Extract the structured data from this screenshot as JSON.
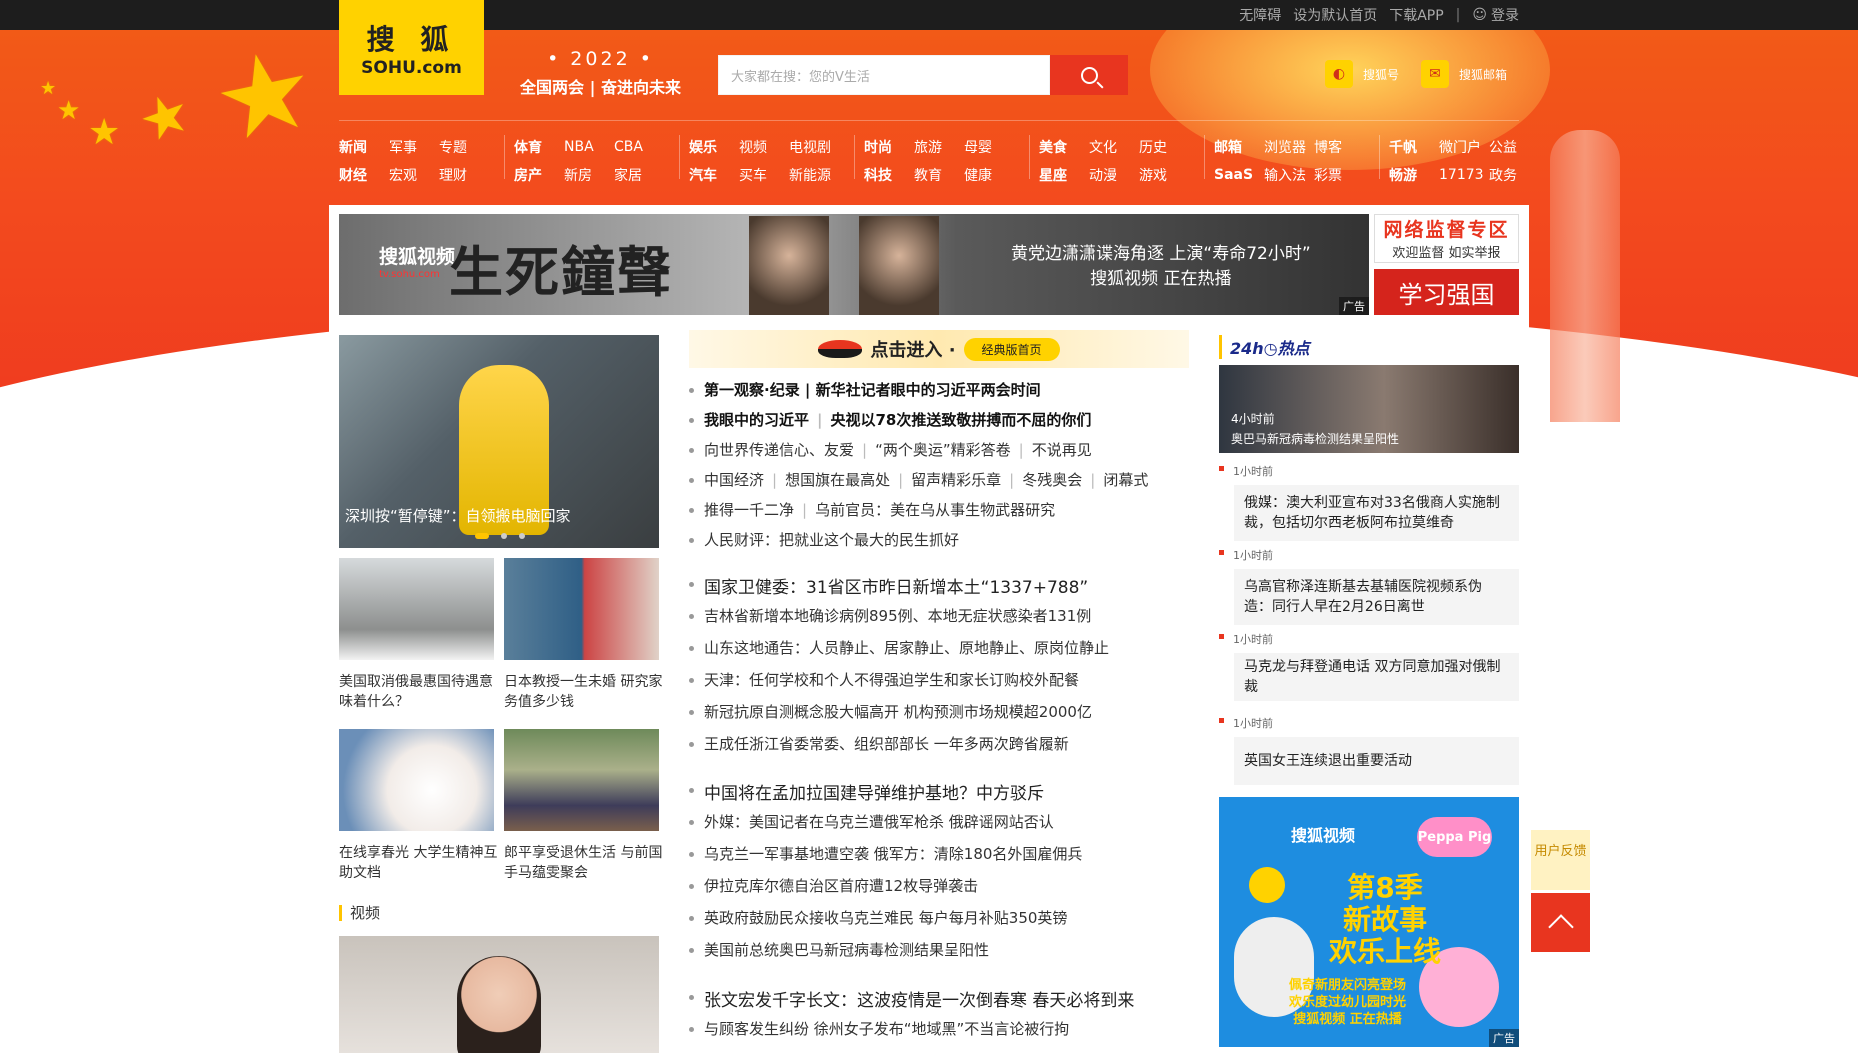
{
  "topbar": {
    "accessibility": "无障碍",
    "set_home": "设为默认首页",
    "download_app": "下载APP",
    "login": "登录"
  },
  "logo": {
    "cn": "搜 狐",
    "en": "SOHU.com"
  },
  "slogan": {
    "year": "• 2022 •",
    "text": "全国两会 | 奋进向未来"
  },
  "search": {
    "placeholder": "大家都在搜：您的V生活"
  },
  "account": {
    "sohuhao": "搜狐号",
    "mail": "搜狐邮箱"
  },
  "nav": {
    "groups": [
      {
        "row1": [
          "新闻",
          "军事",
          "专题"
        ],
        "row2": [
          "财经",
          "宏观",
          "理财"
        ]
      },
      {
        "row1": [
          "体育",
          "NBA",
          "CBA"
        ],
        "row2": [
          "房产",
          "新房",
          "家居"
        ]
      },
      {
        "row1": [
          "娱乐",
          "视频",
          "电视剧"
        ],
        "row2": [
          "汽车",
          "买车",
          "新能源"
        ]
      },
      {
        "row1": [
          "时尚",
          "旅游",
          "母婴"
        ],
        "row2": [
          "科技",
          "教育",
          "健康"
        ]
      },
      {
        "row1": [
          "美食",
          "文化",
          "历史"
        ],
        "row2": [
          "星座",
          "动漫",
          "游戏"
        ]
      },
      {
        "row1": [
          "邮箱",
          "浏览器",
          "博客"
        ],
        "row2": [
          "SaaS",
          "输入法",
          "彩票"
        ]
      },
      {
        "row1": [
          "千帆",
          "微门户",
          "公益"
        ],
        "row2": [
          "畅游",
          "17173",
          "政务"
        ]
      }
    ]
  },
  "ad_banner": {
    "brand": "搜狐视频",
    "brand_url": "tv.sohu.com",
    "title": "生死鐘聲",
    "line1": "黄党边潇潇谍海角逐 上演“寿命72小时”",
    "line2": "搜狐视频 正在热播",
    "ad_label": "广告"
  },
  "side_ads": {
    "netmon_title": "网络监督专区",
    "netmon_sub": "欢迎监督 如实举报",
    "xuexi": "学习强国"
  },
  "feature": {
    "caption": "深圳按“暂停键”：自领搬电脑回家"
  },
  "thumbs": [
    {
      "caption": "美国取消俄最惠国待遇意味着什么？"
    },
    {
      "caption": "日本教授一生未婚 研究家务值多少钱"
    },
    {
      "caption": "在线享春光 大学生精神互助文档"
    },
    {
      "caption": "郎平享受退休生活 与前国手马蕴雯聚会"
    }
  ],
  "video_section": {
    "title": "视频"
  },
  "enter_banner": {
    "text": "点击进入 ·",
    "pill": "经典版首页"
  },
  "news": {
    "group1": [
      {
        "items": [
          "第一观察·纪录 | 新华社记者眼中的习近平两会时间"
        ]
      },
      {
        "items": [
          "我眼中的习近平",
          "央视以78次推送致敬拼搏而不屈的你们"
        ]
      },
      {
        "items": [
          "向世界传递信心、友爱",
          "“两个奥运”精彩答卷",
          "不说再见"
        ]
      },
      {
        "items": [
          "中国经济",
          "想国旗在最高处",
          "留声精彩乐章",
          "冬残奥会",
          "闭幕式"
        ]
      },
      {
        "items": [
          "推得一千二净",
          "乌前官员：美在乌从事生物武器研究"
        ]
      },
      {
        "items": [
          "人民财评：把就业这个最大的民生抓好"
        ]
      }
    ],
    "group2": [
      "国家卫健委：31省区市昨日新增本土“1337+788”",
      "吉林省新增本地确诊病例895例、本地无症状感染者131例",
      "山东这地通告：人员静止、居家静止、原地静止、原岗位静止",
      "天津：任何学校和个人不得强迫学生和家长订购校外配餐",
      "新冠抗原自测概念股大幅高开 机构预测市场规模超2000亿",
      "王成任浙江省委常委、组织部部长 一年多两次跨省履新"
    ],
    "group3": [
      "中国将在孟加拉国建导弹维护基地？中方驳斥",
      "外媒：美国记者在乌克兰遭俄军枪杀 俄辟谣网站否认",
      "乌克兰一军事基地遭空袭 俄军方：清除180名外国雇佣兵",
      "伊拉克库尔德自治区首府遭12枚导弹袭击",
      "英政府鼓励民众接收乌克兰难民 每户每月补贴350英镑",
      "美国前总统奥巴马新冠病毒检测结果呈阳性"
    ],
    "group4": [
      "张文宏发千字长文：这波疫情是一次倒春寒 春天必将到来",
      "与顾客发生纠纷 徐州女子发布“地域黑”不当言论被行拘"
    ]
  },
  "hot24": {
    "logo": "24h◷热点",
    "top_time": "4小时前",
    "top_title": "奥巴马新冠病毒检测结果呈阳性",
    "items": [
      {
        "time": "1小时前",
        "title": "俄媒：澳大利亚宣布对33名俄商人实施制裁，包括切尔西老板阿布拉莫维奇"
      },
      {
        "time": "1小时前",
        "title": "乌高官称泽连斯基去基辅医院视频系伪造：同行人早在2月26日离世"
      },
      {
        "time": "1小时前",
        "title": "马克龙与拜登通电话 双方同意加强对俄制裁"
      },
      {
        "time": "1小时前",
        "title": "英国女王连续退出重要活动"
      }
    ]
  },
  "peppa_ad": {
    "brand": "搜狐视频",
    "pp": "Peppa Pig",
    "season": "第8季",
    "line1": "新故事",
    "line2": "欢乐上线",
    "bot1": "佩奇新朋友闪亮登场",
    "bot2": "欢乐度过幼儿园时光",
    "bot3": "搜狐视频 正在热播",
    "ad_label": "广告"
  },
  "float": {
    "feedback": "用户反馈"
  }
}
